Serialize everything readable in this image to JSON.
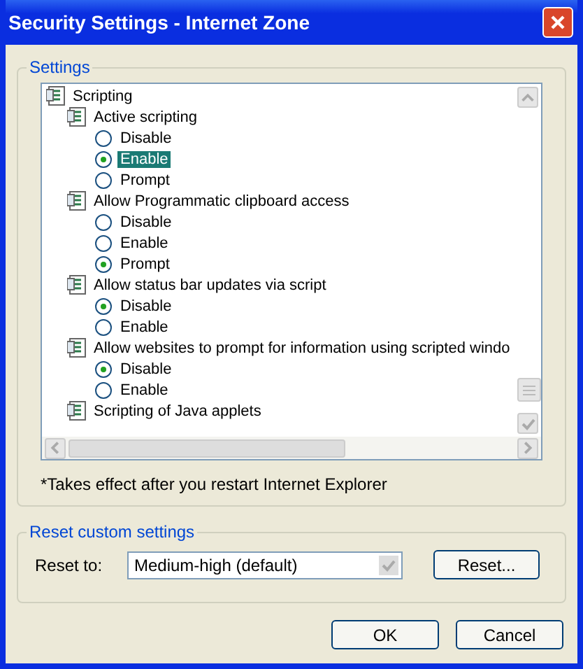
{
  "window": {
    "title": "Security Settings - Internet Zone"
  },
  "settings": {
    "title": "Settings",
    "tree": [
      {
        "label": "Scripting",
        "children": [
          {
            "label": "Active scripting",
            "options": [
              {
                "label": "Disable",
                "selected": false,
                "highlighted": false
              },
              {
                "label": "Enable",
                "selected": true,
                "highlighted": true
              },
              {
                "label": "Prompt",
                "selected": false,
                "highlighted": false
              }
            ]
          },
          {
            "label": "Allow Programmatic clipboard access",
            "options": [
              {
                "label": "Disable",
                "selected": false,
                "highlighted": false
              },
              {
                "label": "Enable",
                "selected": false,
                "highlighted": false
              },
              {
                "label": "Prompt",
                "selected": true,
                "highlighted": false
              }
            ]
          },
          {
            "label": "Allow status bar updates via script",
            "options": [
              {
                "label": "Disable",
                "selected": true,
                "highlighted": false
              },
              {
                "label": "Enable",
                "selected": false,
                "highlighted": false
              }
            ]
          },
          {
            "label": "Allow websites to prompt for information using scripted windo",
            "options": [
              {
                "label": "Disable",
                "selected": true,
                "highlighted": false
              },
              {
                "label": "Enable",
                "selected": false,
                "highlighted": false
              }
            ]
          },
          {
            "label": "Scripting of Java applets"
          }
        ]
      }
    ],
    "note": "*Takes effect after you restart Internet Explorer"
  },
  "reset": {
    "title": "Reset custom settings",
    "label": "Reset to:",
    "value": "Medium-high (default)",
    "button": "Reset..."
  },
  "buttons": [
    "OK",
    "Cancel"
  ]
}
